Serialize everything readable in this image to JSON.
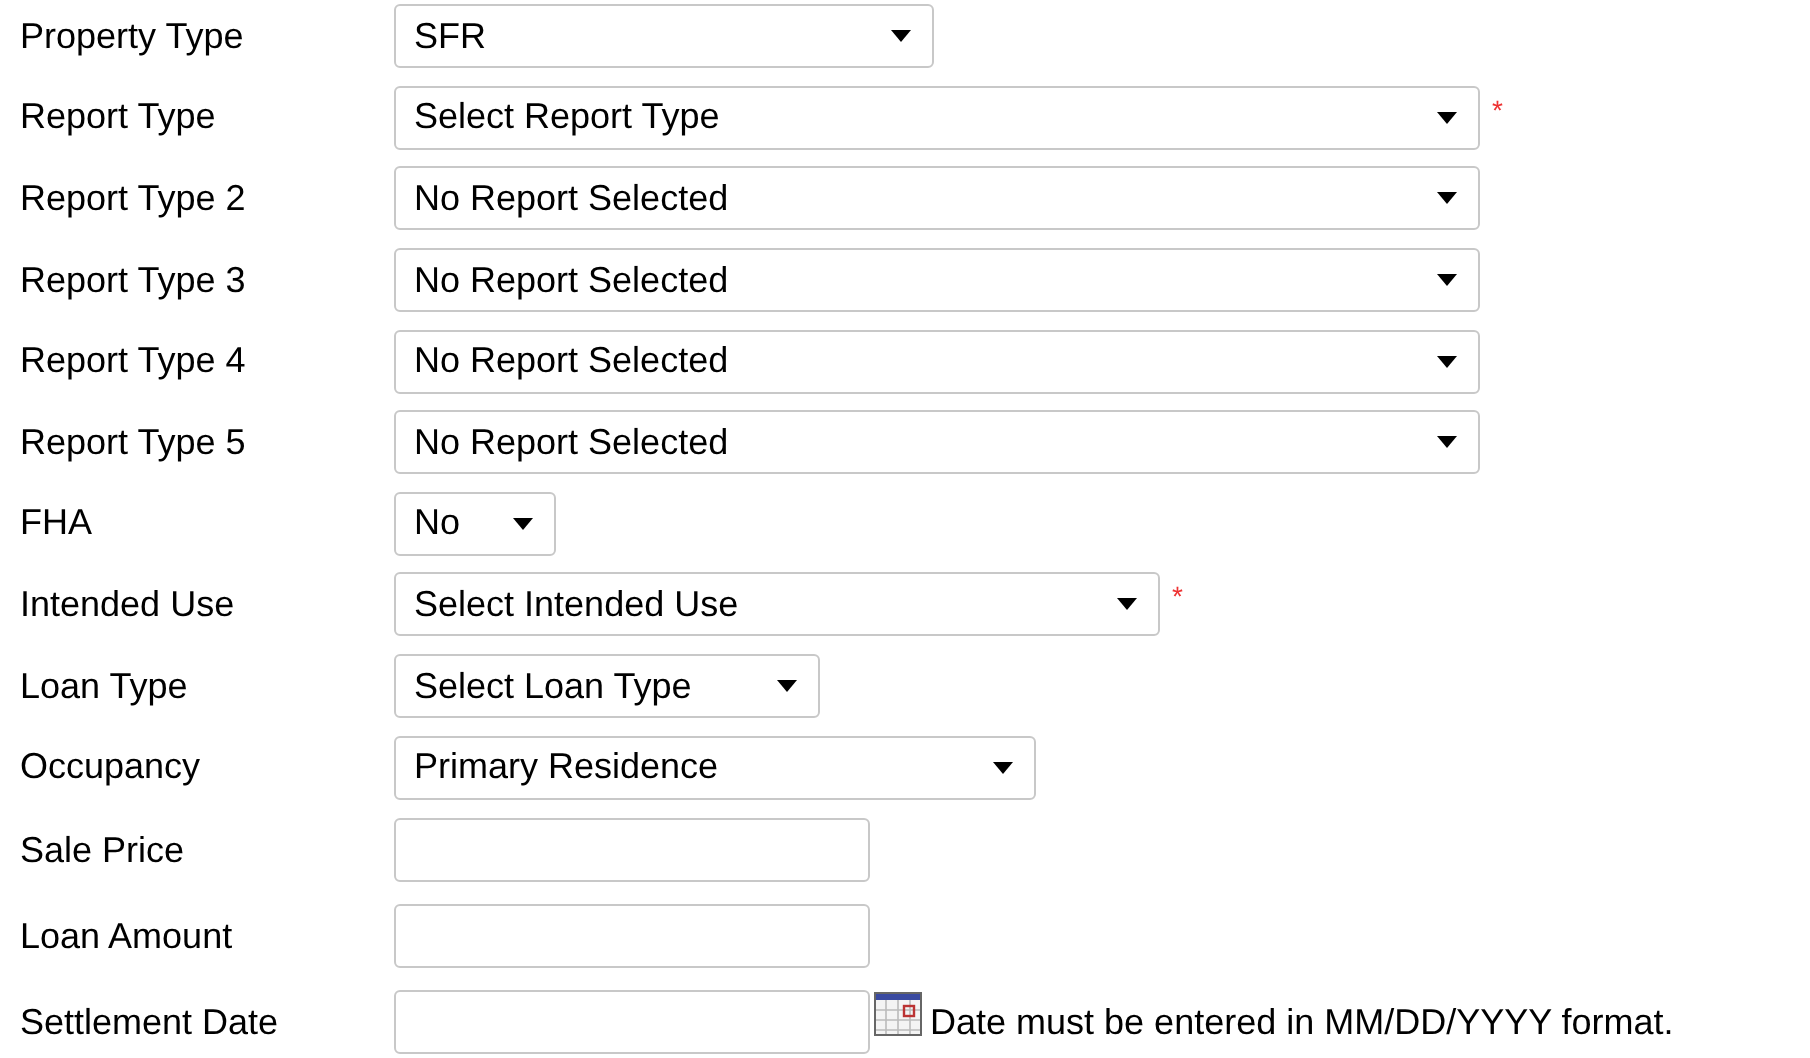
{
  "fields": [
    {
      "label": "Property Type",
      "kind": "select",
      "value": "SFR"
    },
    {
      "label": "Report Type",
      "kind": "select",
      "value": "Select Report Type",
      "required_mark": "*"
    },
    {
      "label": "Report Type 2",
      "kind": "select",
      "value": "No Report Selected"
    },
    {
      "label": "Report Type 3",
      "kind": "select",
      "value": "No Report Selected"
    },
    {
      "label": "Report Type 4",
      "kind": "select",
      "value": "No Report Selected"
    },
    {
      "label": "Report Type 5",
      "kind": "select",
      "value": "No Report Selected"
    },
    {
      "label": "FHA",
      "kind": "select",
      "value": "No"
    },
    {
      "label": "Intended Use",
      "kind": "select",
      "value": "Select Intended Use",
      "required_mark": "*"
    },
    {
      "label": "Loan Type",
      "kind": "select",
      "value": "Select Loan Type"
    },
    {
      "label": "Occupancy",
      "kind": "select",
      "value": "Primary Residence"
    },
    {
      "label": "Sale Price",
      "kind": "text"
    },
    {
      "label": "Loan Amount",
      "kind": "text"
    },
    {
      "label": "Settlement Date",
      "kind": "date",
      "hint": "Date must be entered in MM/DD/YYYY format."
    }
  ]
}
